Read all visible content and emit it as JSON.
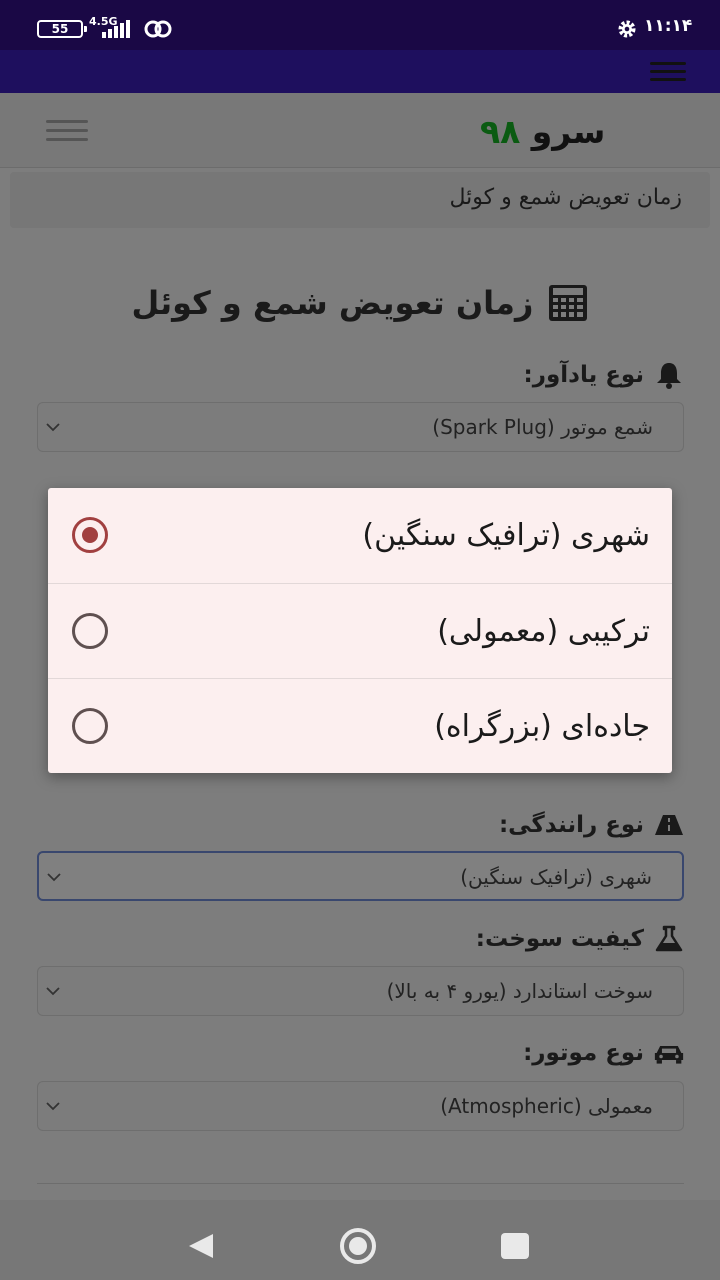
{
  "status_bar": {
    "battery": "55",
    "network": "4.5G",
    "time": "۱۱:۱۴"
  },
  "header": {
    "logo_word": "سرو",
    "logo_number": "۹۸"
  },
  "breadcrumb": "زمان تعویض شمع و کوئل",
  "page_title": "زمان تعویض شمع و کوئل",
  "form": {
    "reminder_type": {
      "label": "نوع یادآور:",
      "value": "شمع موتور (Spark Plug)"
    },
    "driving_type": {
      "label": "نوع رانندگی:",
      "value": "شهری (ترافیک سنگین)"
    },
    "fuel_quality": {
      "label": "کیفیت سوخت:",
      "value": "سوخت استاندارد (یورو ۴ به بالا)"
    },
    "engine_type": {
      "label": "نوع موتور:",
      "value": "معمولی (Atmospheric)"
    }
  },
  "dialog": {
    "options": [
      {
        "label": "شهری (ترافیک سنگین)",
        "selected": true
      },
      {
        "label": "ترکیبی (معمولی)",
        "selected": false
      },
      {
        "label": "جاده‌ای (بزرگراه)",
        "selected": false
      }
    ]
  },
  "colors": {
    "status_bar": "#1a0845",
    "app_bar": "#1e0f5e",
    "logo_number": "#0b5b12",
    "radio_selected": "#a14040",
    "dialog_bg": "#fcefef"
  }
}
